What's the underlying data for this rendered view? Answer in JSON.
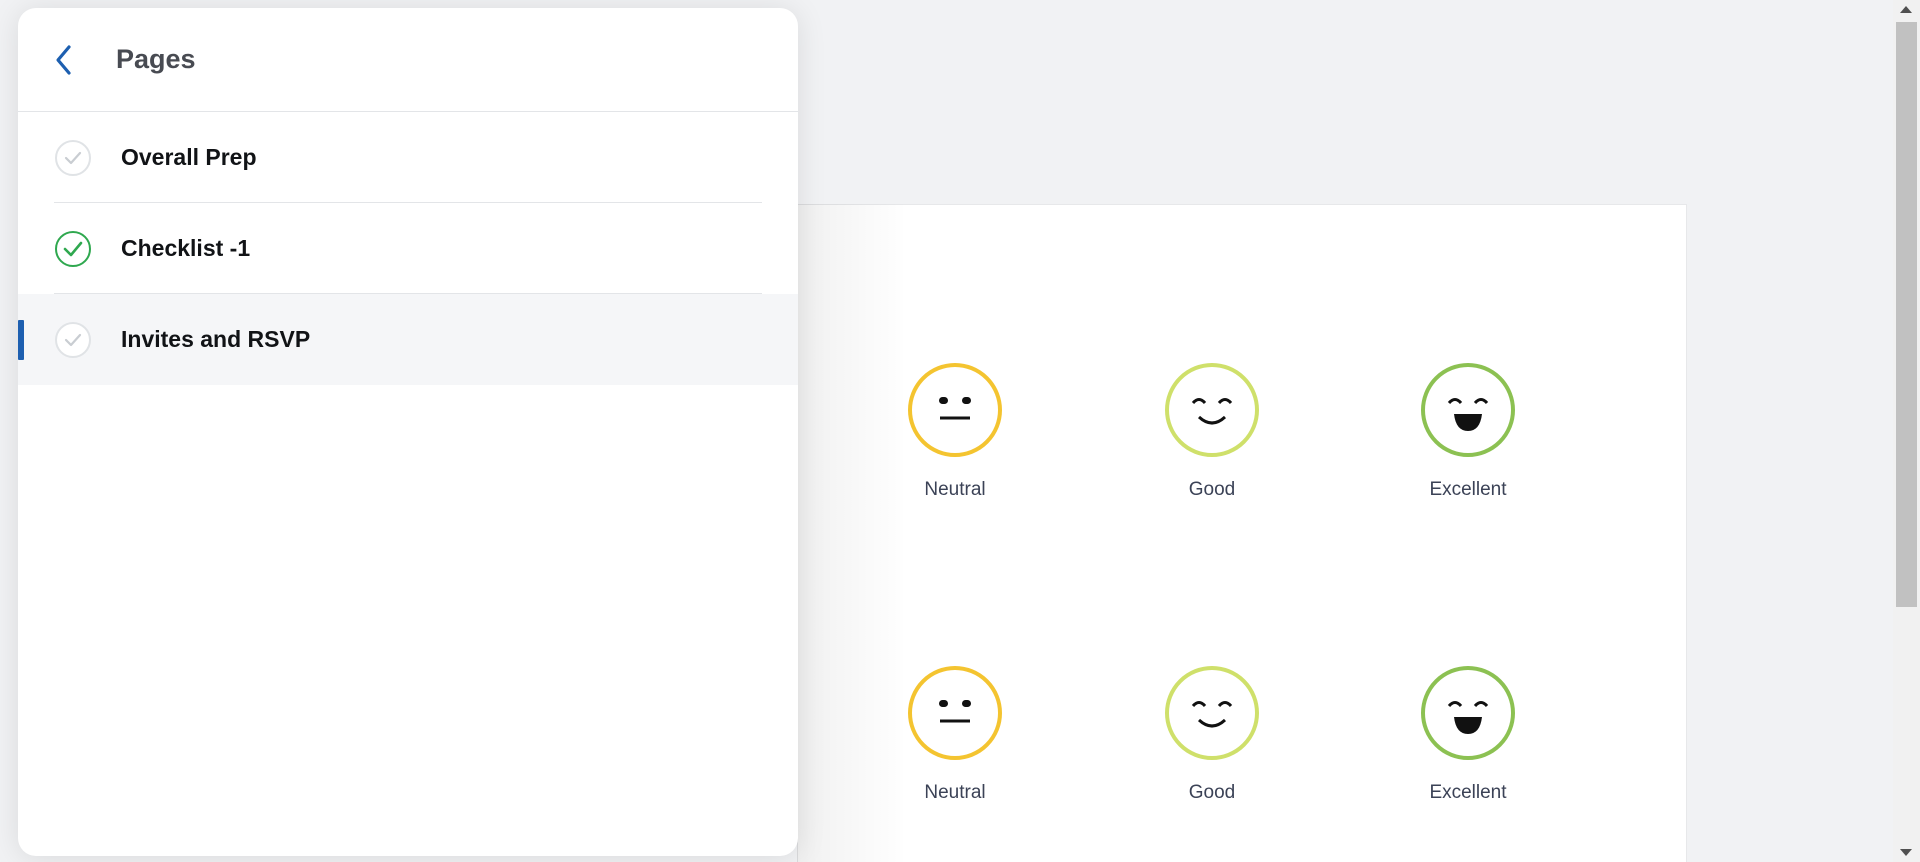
{
  "drawer": {
    "title": "Pages",
    "back_icon": "chevron-left-icon",
    "items": [
      {
        "label": "Overall Prep",
        "status": "incomplete",
        "active": false
      },
      {
        "label": "Checklist -1",
        "status": "complete",
        "active": false
      },
      {
        "label": "Invites and RSVP",
        "status": "incomplete",
        "active": true
      }
    ]
  },
  "ratings": {
    "row1": [
      {
        "label": "Neutral",
        "icon": "neutral-face-icon",
        "color": "#f4c430"
      },
      {
        "label": "Good",
        "icon": "smile-face-icon",
        "color": "#cfe06a"
      },
      {
        "label": "Excellent",
        "icon": "laughing-face-icon",
        "color": "#8cc152"
      }
    ],
    "row2": [
      {
        "label": "Neutral",
        "icon": "neutral-face-icon",
        "color": "#f4c430"
      },
      {
        "label": "Good",
        "icon": "smile-face-icon",
        "color": "#cfe06a"
      },
      {
        "label": "Excellent",
        "icon": "laughing-face-icon",
        "color": "#8cc152"
      }
    ]
  },
  "colors": {
    "accent": "#1d5fb0",
    "complete_check": "#2fa84f",
    "incomplete_check": "#c9cdd2"
  }
}
